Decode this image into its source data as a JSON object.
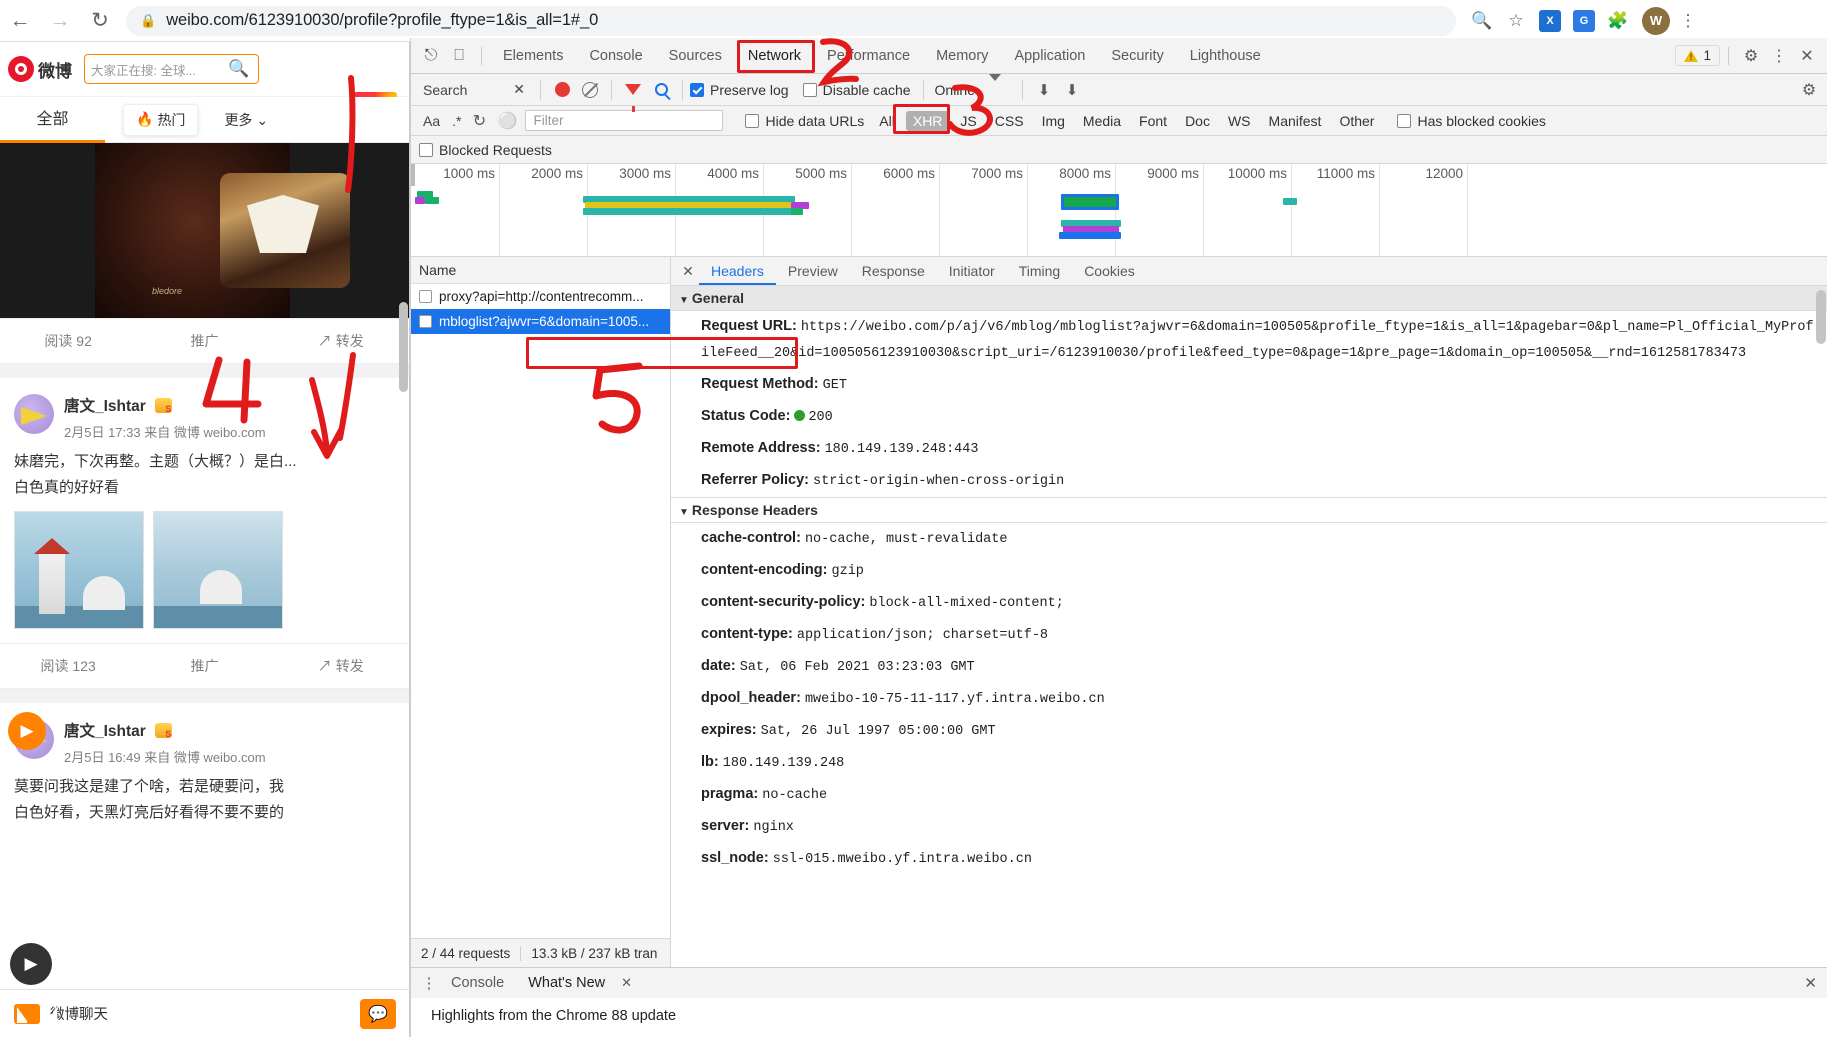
{
  "browser": {
    "back_icon": "back-arrow-icon",
    "forward_icon": "forward-arrow-icon",
    "reload_icon": "reload-icon",
    "lock_icon": "lock-icon",
    "url": "weibo.com/6123910030/profile?profile_ftype=1&is_all=1#_0",
    "url_host": "weibo.com",
    "url_path": "/6123910030/profile?profile_ftype=1&is_all=1#_0",
    "zoom_icon": "zoom-icon",
    "bookmark_icon": "star-icon",
    "ext1_label": "X",
    "ext2_label": "G",
    "ext3_icon": "puzzle-icon",
    "profile_initial": "W",
    "menu_icon": "kebab-menu-icon"
  },
  "weibo": {
    "brand": "微博",
    "search_placeholder": "大家正在搜: 全球...",
    "tab_all": "全部",
    "tab_hot": "热门",
    "tab_more": "更多",
    "photo_caption": "bledore",
    "post1": {
      "reads": "阅读 92",
      "promote": "推广",
      "forward": "转发"
    },
    "post2": {
      "username": "唐文_Ishtar",
      "meta": "2月5日 17:33 来自 微博 weibo.com",
      "text_line1": "妹磨完，下次再整。主题（大概？）是白...",
      "text_line2": "白色真的好好看",
      "reads": "阅读 123",
      "promote": "推广",
      "forward": "转发"
    },
    "post3": {
      "username": "唐文_Ishtar",
      "meta": "2月5日 16:49 来自 微博 weibo.com",
      "text_line1": "莫要问我这是建了个啥，若是硬要问，我",
      "text_line2": "白色好看，天黑灯亮后好看得不要不要的"
    },
    "chat_label": "微博聊天"
  },
  "devtools": {
    "tabs": [
      "Elements",
      "Console",
      "Sources",
      "Network",
      "Performance",
      "Memory",
      "Application",
      "Security",
      "Lighthouse"
    ],
    "selected_tab": "Network",
    "inspect_icon": "inspect-element-icon",
    "device_icon": "device-toolbar-icon",
    "warning_count": "1",
    "settings_icon": "gear-icon",
    "more_icon": "kebab-menu-icon",
    "close_icon": "close-icon",
    "network_toolbar": {
      "search_label": "Search",
      "search_close_icon": "close-icon",
      "record_icon": "record-icon",
      "clear_icon": "clear-icon",
      "filter_icon": "filter-funnel-icon",
      "search_icon": "search-icon",
      "preserve_log_label": "Preserve log",
      "preserve_log_checked": true,
      "disable_cache_label": "Disable cache",
      "disable_cache_checked": false,
      "throttle_value": "Online",
      "throttle_caret_icon": "chevron-down-icon",
      "import_icon": "upload-arrow-icon",
      "export_icon": "download-arrow-icon",
      "settings_icon": "gear-icon"
    },
    "filter_bar": {
      "filter_placeholder": "Filter",
      "regex_label": "Aa",
      "regex2_label": ".*",
      "refresh_icon": "reload-icon",
      "hide_data_urls_label": "Hide data URLs",
      "hide_data_urls_checked": false,
      "types": [
        "All",
        "XHR",
        "JS",
        "CSS",
        "Img",
        "Media",
        "Font",
        "Doc",
        "WS",
        "Manifest",
        "Other"
      ],
      "active_type": "XHR",
      "has_blocked_cookies_label": "Has blocked cookies",
      "has_blocked_cookies_checked": false,
      "blocked_requests_label": "Blocked Requests",
      "blocked_requests_checked": false
    },
    "timeline": {
      "ticks": [
        "1000 ms",
        "2000 ms",
        "3000 ms",
        "4000 ms",
        "5000 ms",
        "6000 ms",
        "7000 ms",
        "8000 ms",
        "9000 ms",
        "10000 ms",
        "11000 ms",
        "12000"
      ]
    },
    "request_list": {
      "column_header": "Name",
      "rows": [
        {
          "name": "proxy?api=http://contentrecomm...",
          "selected": false
        },
        {
          "name": "mbloglist?ajwvr=6&domain=1005...",
          "selected": true
        }
      ],
      "status": {
        "requests": "2 / 44 requests",
        "transferred": "13.3 kB / 237 kB tran"
      }
    },
    "detail": {
      "tabs": [
        "Headers",
        "Preview",
        "Response",
        "Initiator",
        "Timing",
        "Cookies"
      ],
      "selected_tab": "Headers",
      "close_icon": "close-icon",
      "general_title": "General",
      "general": [
        {
          "key": "Request URL:",
          "value": "https://weibo.com/p/aj/v6/mblog/mbloglist?ajwvr=6&domain=100505&profile_ftype=1&is_all=1&pagebar=0&pl_name=Pl_Official_MyProfileFeed__20&id=1005056123910030&script_uri=/6123910030/profile&feed_type=0&page=1&pre_page=1&domain_op=100505&__rnd=1612581783473"
        },
        {
          "key": "Request Method:",
          "value": "GET"
        },
        {
          "key": "Status Code:",
          "value": "200",
          "status_dot": true
        },
        {
          "key": "Remote Address:",
          "value": "180.149.139.248:443"
        },
        {
          "key": "Referrer Policy:",
          "value": "strict-origin-when-cross-origin"
        }
      ],
      "response_headers_title": "Response Headers",
      "response_headers": [
        {
          "key": "cache-control:",
          "value": "no-cache, must-revalidate"
        },
        {
          "key": "content-encoding:",
          "value": "gzip"
        },
        {
          "key": "content-security-policy:",
          "value": "block-all-mixed-content;"
        },
        {
          "key": "content-type:",
          "value": "application/json; charset=utf-8"
        },
        {
          "key": "date:",
          "value": "Sat, 06 Feb 2021 03:23:03 GMT"
        },
        {
          "key": "dpool_header:",
          "value": "mweibo-10-75-11-117.yf.intra.weibo.cn"
        },
        {
          "key": "expires:",
          "value": "Sat, 26 Jul 1997 05:00:00 GMT"
        },
        {
          "key": "lb:",
          "value": "180.149.139.248"
        },
        {
          "key": "pragma:",
          "value": "no-cache"
        },
        {
          "key": "server:",
          "value": "nginx"
        },
        {
          "key": "ssl_node:",
          "value": "ssl-015.mweibo.yf.intra.weibo.cn"
        }
      ]
    },
    "drawer": {
      "more_icon": "kebab-menu-icon",
      "tabs": [
        "Console",
        "What's New"
      ],
      "selected_tab": "What's New",
      "tab_close_icon": "close-icon",
      "close_icon": "close-icon",
      "content": "Highlights from the Chrome 88 update"
    }
  },
  "annotations": {
    "marks": [
      "1",
      "2",
      "3",
      "4",
      "5"
    ],
    "color": "#e01b1b"
  }
}
